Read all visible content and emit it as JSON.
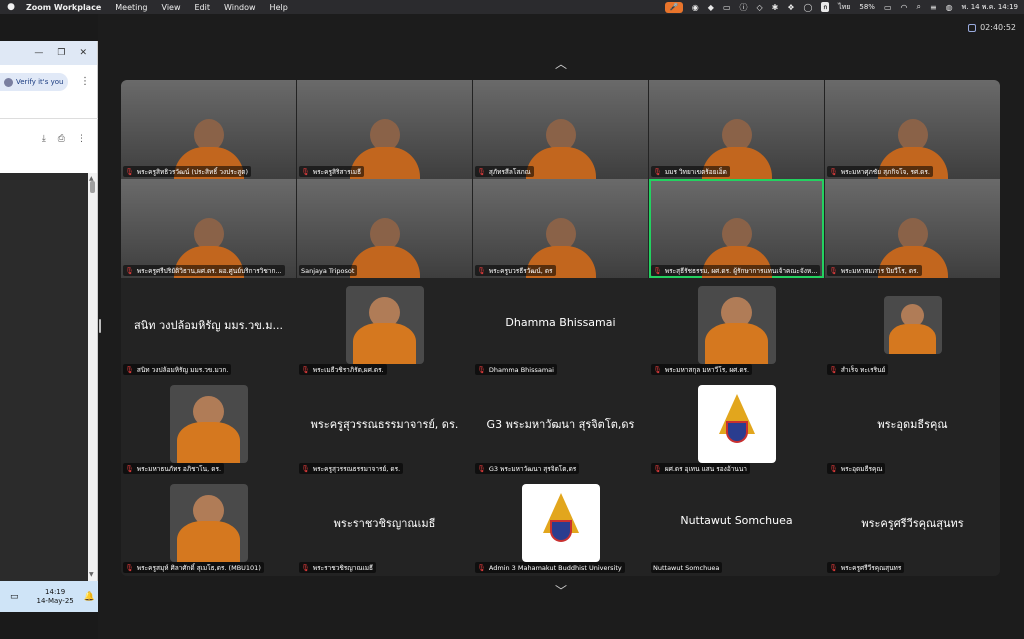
{
  "menubar": {
    "app_name": "Zoom Workplace",
    "items": [
      "Meeting",
      "View",
      "Edit",
      "Window",
      "Help"
    ],
    "keyboard_badge": "ก",
    "input_lang": "ไทย",
    "battery": "58%",
    "datetime": "พ. 14 พ.ค.  14:19"
  },
  "zoom": {
    "meeting_timer": "02:40:52",
    "tiles": [
      {
        "name": "พระครูสิทธิวรวัฒน์ (ประสิทธิ์ วงประสูต)",
        "kind": "video",
        "muted": true
      },
      {
        "name": "พระครูสิริสารเมธี",
        "kind": "video",
        "muted": true
      },
      {
        "name": "สุภัทรสีลโสภณ",
        "kind": "video",
        "muted": true
      },
      {
        "name": "มมร วิทยาเขตร้อยเอ็ด",
        "kind": "video",
        "muted": true
      },
      {
        "name": "พระมหาศุภชัย สุภกิจโจ, รศ.ดร.",
        "kind": "video",
        "muted": true
      },
      {
        "name": "พระครูศรีปริยัติวิธาน,ผศ.ดร. ผอ.ศูนย์บริการวิชาก...",
        "kind": "video",
        "muted": true
      },
      {
        "name": "Sanjaya Triposot",
        "kind": "video",
        "muted": false
      },
      {
        "name": "พระครูบวรธีรวัฒน์, ดร",
        "kind": "video",
        "muted": true
      },
      {
        "name": "พระสุธีรัชธรรม, ผศ.ดร. ผู้รักษาการแทนเจ้าคณะจังห...",
        "kind": "video",
        "muted": true,
        "active": true
      },
      {
        "name": "พระมหาสมภาร ปิยวีโร, ดร.",
        "kind": "video",
        "muted": true
      },
      {
        "name": "สนิท  วงปล้อมหิรัญ มมร.วข.มวก.",
        "kind": "text",
        "big": "สนิท  วงปล้อมหิรัญ มมร.วข.ม...",
        "muted": true
      },
      {
        "name": "พระเมธีวชิราภิรัต,ผศ.ดร.",
        "kind": "avatar",
        "muted": true
      },
      {
        "name": "Dhamma Bhissamai",
        "kind": "text",
        "big": "Dhamma Bhissamai",
        "muted": true
      },
      {
        "name": "พระมหาสกุล มหาวีโร, ผศ.ดร.",
        "kind": "avatar",
        "muted": true
      },
      {
        "name": "สำเร็จ ทะเรรินย์",
        "kind": "avatar-small",
        "muted": true
      },
      {
        "name": "พระมหาธนภัทร อภิชาโน, ดร.",
        "kind": "avatar",
        "muted": true
      },
      {
        "name": "พระครูสุวรรณธรรมาจารย์, ดร.",
        "kind": "text",
        "big": "พระครูสุวรรณธรรมาจารย์, ดร.",
        "muted": true
      },
      {
        "name": "G3 พระมหาวัฒนา สุรจิตโต,ดร",
        "kind": "text",
        "big": "G3 พระมหาวัฒนา สุรจิตโต,ดร",
        "muted": true
      },
      {
        "name": "ผศ.ดร อุเทน แสน รองอ้านนา",
        "kind": "emblem",
        "muted": true
      },
      {
        "name": "พระอุดมธีรคุณ",
        "kind": "text",
        "big": "พระอุดมธีรคุณ",
        "muted": true
      },
      {
        "name": "พระครูสมุห์ ศิลาศักดิ์ สุเมโธ,ดร. (MBU101)",
        "kind": "avatar",
        "muted": true
      },
      {
        "name": "พระราชวชิรญาณเมธี",
        "kind": "text",
        "big": "พระราชวชิรญาณเมธี",
        "muted": true
      },
      {
        "name": "Admin 3 Mahamakut Buddhist University",
        "kind": "emblem",
        "muted": true
      },
      {
        "name": "Nuttawut Somchuea",
        "kind": "text",
        "big": "Nuttawut Somchuea",
        "muted": false
      },
      {
        "name": "พระครูศรีวีรคุณสุนทร",
        "kind": "text",
        "big": "พระครูศรีวีรคุณสุนทร",
        "muted": true
      }
    ]
  },
  "browser": {
    "verify_label": "Verify it's you"
  },
  "taskbar": {
    "time": "14:19",
    "date": "14-May-25"
  },
  "colors": {
    "active_speaker": "#23d160",
    "mic_active": "#e8742b",
    "muted_icon": "#e03b3b"
  }
}
